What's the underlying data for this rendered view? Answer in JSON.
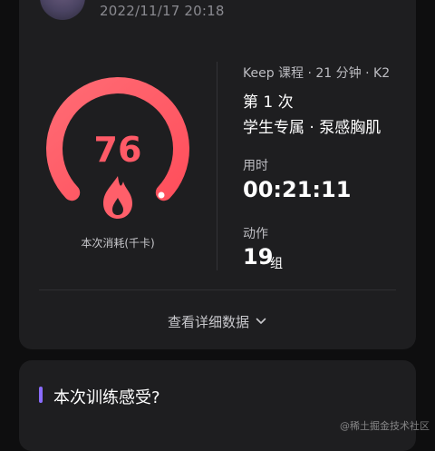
{
  "header": {
    "datetime": "2022/11/17 20:18"
  },
  "summary": {
    "calories_value": "76",
    "calories_label": "本次消耗(千卡)",
    "gauge_level_percent": 75,
    "course_meta": "Keep 课程 · 21 分钟 · K2",
    "session": "第 1 次",
    "plan_name": "学生专属 · 泵感胸肌",
    "time_label": "用时",
    "time_value": "00:21:11",
    "actions_label": "动作",
    "actions_value": "19",
    "actions_unit": "组",
    "details_label": "查看详细数据"
  },
  "feeling": {
    "title": "本次训练感受?"
  },
  "watermark": "@稀土掘金技术社区",
  "colors": {
    "accent": "#ff5a67",
    "purple": "#8a6cff",
    "background": "#0e0e0f",
    "card": "#1e1e20"
  },
  "icons": [
    "avatar",
    "flame-icon",
    "chevron-down-icon"
  ]
}
